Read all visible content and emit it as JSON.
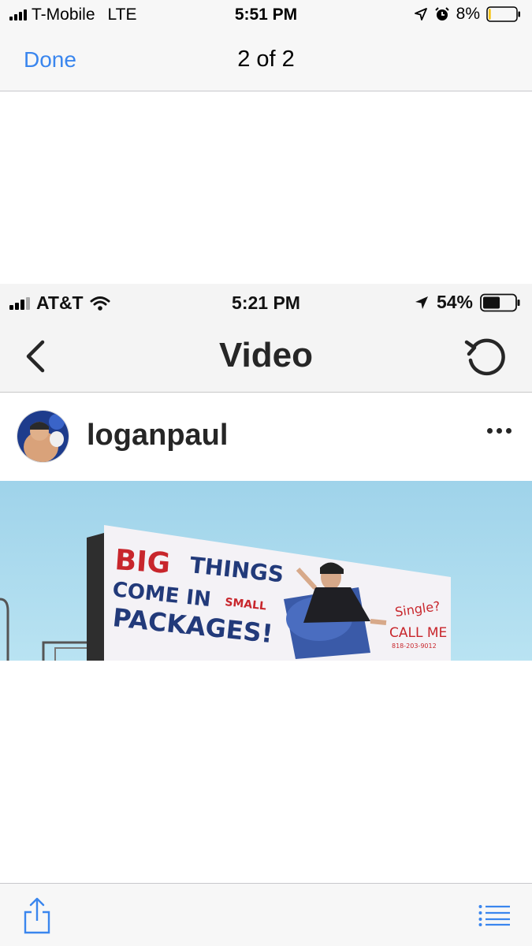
{
  "status_bar": {
    "carrier": "T-Mobile",
    "network": "LTE",
    "time": "5:51 PM",
    "battery": "8%",
    "battery_level": 0.08,
    "icons": [
      "signal-icon",
      "location-arrow-icon",
      "alarm-clock-icon",
      "battery-icon"
    ]
  },
  "nav": {
    "done_label": "Done",
    "title": "2 of 2"
  },
  "embedded": {
    "status_bar": {
      "carrier": "AT&T",
      "time": "5:21 PM",
      "battery": "54%",
      "battery_level": 0.54,
      "icons": [
        "signal-icon",
        "wifi-icon",
        "location-arrow-icon",
        "battery-icon"
      ]
    },
    "nav": {
      "title": "Video",
      "icons": [
        "back-chevron-icon",
        "replay-icon"
      ]
    },
    "post": {
      "username": "loganpaul",
      "more_icon": "more-dots-icon"
    },
    "billboard": {
      "word_big": "BIG",
      "word_things": "THINGS",
      "line2": "COME IN",
      "word_small": "SMALL",
      "line3": "PACKAGES!",
      "single": "Single?",
      "call_me": "CALL ME",
      "phone": "818-203-9012"
    }
  },
  "toolbar": {
    "icons": [
      "share-icon",
      "list-icon"
    ]
  },
  "colors": {
    "accent": "#3a86ee",
    "bar_bg": "#f7f7f7",
    "billboard_red": "#c8262c",
    "billboard_blue": "#223a7a",
    "sky": "#a9d9ec",
    "battery_low": "#f5c518"
  }
}
